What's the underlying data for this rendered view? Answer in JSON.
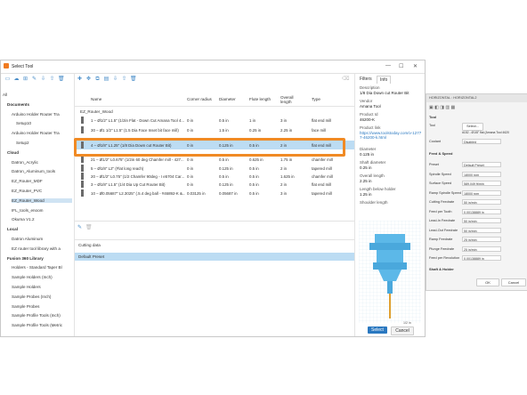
{
  "window": {
    "title": "Select Tool",
    "min": "—",
    "max": "☐",
    "close": "✕"
  },
  "left": {
    "tree": [
      {
        "label": "All",
        "indent": 0,
        "bold": false
      },
      {
        "label": "Documents",
        "indent": 1,
        "bold": true
      },
      {
        "label": "Arduino Holder Router Tra",
        "indent": 2,
        "bold": false
      },
      {
        "label": "Setup10",
        "indent": 3,
        "bold": false
      },
      {
        "label": "Arduino Holder Router Tra",
        "indent": 2,
        "bold": false
      },
      {
        "label": "Setup2",
        "indent": 3,
        "bold": false
      },
      {
        "label": "Cloud",
        "indent": 1,
        "bold": true
      },
      {
        "label": "Datron_Acrylic",
        "indent": 2,
        "bold": false
      },
      {
        "label": "Datron_Aluminum_tools",
        "indent": 2,
        "bold": false
      },
      {
        "label": "EZ_Router_MDF",
        "indent": 2,
        "bold": false
      },
      {
        "label": "EZ_Router_PVC",
        "indent": 2,
        "bold": false
      },
      {
        "label": "EZ_Router_Wood",
        "indent": 2,
        "bold": false,
        "selected": true
      },
      {
        "label": "IFL_tools_enoom",
        "indent": 2,
        "bold": false
      },
      {
        "label": "Okuma V1.2",
        "indent": 2,
        "bold": false
      },
      {
        "label": "Local",
        "indent": 1,
        "bold": true
      },
      {
        "label": "Datron Aluminum",
        "indent": 2,
        "bold": false
      },
      {
        "label": "EZ router tool library with a",
        "indent": 2,
        "bold": false
      },
      {
        "label": "Fusion 360 Library",
        "indent": 1,
        "bold": true
      },
      {
        "label": "Holders - Standard Taper Bl",
        "indent": 2,
        "bold": false
      },
      {
        "label": "Sample Holders (Inch)",
        "indent": 2,
        "bold": false
      },
      {
        "label": "Sample Holders",
        "indent": 2,
        "bold": false
      },
      {
        "label": "Sample Probes (Inch)",
        "indent": 2,
        "bold": false
      },
      {
        "label": "Sample Probes",
        "indent": 2,
        "bold": false
      },
      {
        "label": "Sample Profile Tools (Inch)",
        "indent": 2,
        "bold": false
      },
      {
        "label": "Sample Profile Tools (Metric",
        "indent": 2,
        "bold": false
      }
    ]
  },
  "table": {
    "columns": [
      "Name",
      "Corner radius",
      "Diameter",
      "Flute length",
      "Overall length",
      "Type"
    ],
    "group": "EZ_Router_Wood",
    "rows": [
      {
        "name": "1 – Ø1/2\" L1.5\" (1/2in Flat - Down Cut Amana Tool 4...",
        "corner": "0 in",
        "dia": "0.5 in",
        "flute": "1 in",
        "overall": "3 in",
        "type": "flat end mill"
      },
      {
        "name": "30 – Ø1 1/2\" L1.5\" (1.5 Dia Face Inset bit face mill)",
        "corner": "0 in",
        "dia": "1.5 in",
        "flute": "0.25 in",
        "overall": "2.25 in",
        "type": "face mill"
      },
      {
        "name": "4 – Ø1/8\" L1.25\" (1/8 Dia Down cut Router Bit)",
        "corner": "0 in",
        "dia": "0.125 in",
        "flute": "0.5 in",
        "overall": "2 in",
        "type": "flat end mill",
        "selected": true
      },
      {
        "name": "21 – Ø1/2\" L0.675\" (1/2in 60 deg Chamfer mill - 427...",
        "corner": "0 in",
        "dia": "0.5 in",
        "flute": "0.625 in",
        "overall": "1.75 in",
        "type": "chamfer mill"
      },
      {
        "name": "5 – Ø1/8\" L2\" (Flat long reach)",
        "corner": "0 in",
        "dia": "0.125 in",
        "flute": "0.5 in",
        "overall": "2 in",
        "type": "tapered mill"
      },
      {
        "name": "20 – Ø1/2\" L0.75\" (1/2 Chamfer 90deg - I e5704 Car...",
        "corner": "0 in",
        "dia": "0.5 in",
        "flute": "0.5 in",
        "overall": "1.625 in",
        "type": "chamfer mill"
      },
      {
        "name": "3 – Ø1/8\" L1.5\" (1/4 Dia Up Cut Router Bit)",
        "corner": "0 in",
        "dia": "0.125 in",
        "flute": "0.5 in",
        "overall": "2 in",
        "type": "flat end mill"
      },
      {
        "name": "10 – Ø0.05687\" L2.3025\" (.5.4 deg ball - #46892-K &...",
        "corner": "0.03125 in",
        "dia": "0.05687 in",
        "flute": "0.5 in",
        "overall": "3 in",
        "type": "tapered mill"
      }
    ]
  },
  "lower": {
    "cutting_data": "Cutting data",
    "preset": "Default Preset"
  },
  "right": {
    "tabs": [
      "Filters",
      "Info"
    ],
    "fields": [
      {
        "label": "Description",
        "value": "1/8 Dia Down cut Router Bit"
      },
      {
        "label": "Vendor",
        "value": "Amana Tool"
      },
      {
        "label": "Product Id",
        "value": "46200-K"
      },
      {
        "label": "Product link",
        "value": "https://www.toolstoday.com/v-12777-46200-k.html",
        "link": true
      },
      {
        "label": "Diameter",
        "value": "0.125 in"
      },
      {
        "label": "Shaft diameter",
        "value": "0.25 in"
      },
      {
        "label": "Overall length",
        "value": "2.25 in"
      },
      {
        "label": "Length below holder",
        "value": "1.25 in"
      },
      {
        "label": "Shoulder length",
        "value": ""
      }
    ],
    "select": "Select",
    "cancel": "Cancel",
    "scale": "1/2 in"
  },
  "fpanel": {
    "header": "HORIZONTAL : HORIZONTAL2",
    "tool_section": "Tool",
    "tool_label": "Tool",
    "tool_btn": "Select...",
    "tool_value": "#152 - Ø1/8\" flat (Amana Tool 4620",
    "coolant_label": "Coolant",
    "coolant_value": "Disabled",
    "feed_section": "Feed & Speed",
    "rows": [
      {
        "label": "Preset",
        "value": "Default Preset"
      },
      {
        "label": "Spindle Speed",
        "value": "18000 rpm"
      },
      {
        "label": "Surface Speed",
        "value": "589.049 ft/min"
      },
      {
        "label": "Ramp Spindle Speed",
        "value": "18000 rpm"
      },
      {
        "label": "Cutting Feedrate",
        "value": "50 in/min"
      },
      {
        "label": "Feed per Tooth",
        "value": "0.00138889 in"
      },
      {
        "label": "Lead-In Feedrate",
        "value": "50 in/min"
      },
      {
        "label": "Lead-Out Feedrate",
        "value": "50 in/min"
      },
      {
        "label": "Ramp Feedrate",
        "value": "25 in/min"
      },
      {
        "label": "Plunge Feedrate",
        "value": "25 in/min"
      },
      {
        "label": "Feed per Revolution",
        "value": "0.00138889 in"
      }
    ],
    "shaft_section": "Shaft & Holder",
    "ok": "OK",
    "cancel": "Cancel"
  }
}
